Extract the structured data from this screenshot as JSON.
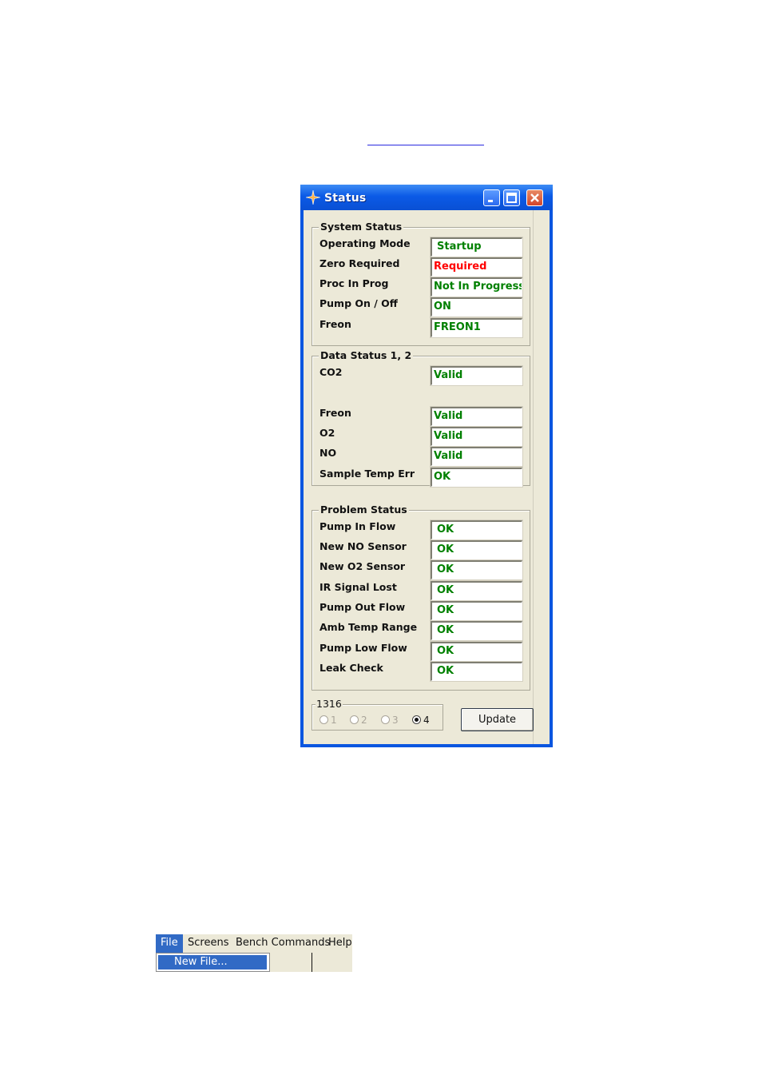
{
  "window": {
    "title": "Status",
    "buttons": {
      "minimize": "minimize-icon",
      "maximize": "maximize-icon",
      "close": "close-icon"
    }
  },
  "system_status": {
    "title": "System Status",
    "rows": [
      {
        "label": "Operating Mode",
        "value": "Startup",
        "color": "#008000"
      },
      {
        "label": "Zero Required",
        "value": "Required",
        "color": "#ff0000"
      },
      {
        "label": "Proc In Prog",
        "value": "Not In Progress",
        "color": "#008000"
      },
      {
        "label": "Pump On / Off",
        "value": "ON",
        "color": "#008000"
      },
      {
        "label": "Freon",
        "value": "FREON1",
        "color": "#008000"
      }
    ]
  },
  "data_status": {
    "title": "Data Status 1, 2",
    "rows": [
      {
        "label": "CO2",
        "value": "Valid"
      },
      {
        "label": "Freon",
        "value": "Valid"
      },
      {
        "label": "O2",
        "value": "Valid"
      },
      {
        "label": "NO",
        "value": "Valid"
      },
      {
        "label": "Sample Temp Err",
        "value": "OK"
      }
    ]
  },
  "problem_status": {
    "title": "Problem Status",
    "rows": [
      {
        "label": "Pump In Flow",
        "value": "OK"
      },
      {
        "label": "New NO Sensor",
        "value": "OK"
      },
      {
        "label": "New O2 Sensor",
        "value": "OK"
      },
      {
        "label": "IR Signal Lost",
        "value": "OK"
      },
      {
        "label": "Pump Out Flow",
        "value": "OK"
      },
      {
        "label": "Amb Temp Range",
        "value": "OK"
      },
      {
        "label": "Pump Low Flow",
        "value": "OK"
      },
      {
        "label": "Leak Check",
        "value": "OK"
      }
    ]
  },
  "bench": {
    "title": "1316",
    "options": [
      "1",
      "2",
      "3",
      "4"
    ],
    "selected": "4"
  },
  "update_button": "Update",
  "menu": {
    "items": [
      "File",
      "Screens",
      "Bench Commands",
      "Help"
    ],
    "open_item": "File",
    "dropdown": [
      "New File..."
    ]
  }
}
